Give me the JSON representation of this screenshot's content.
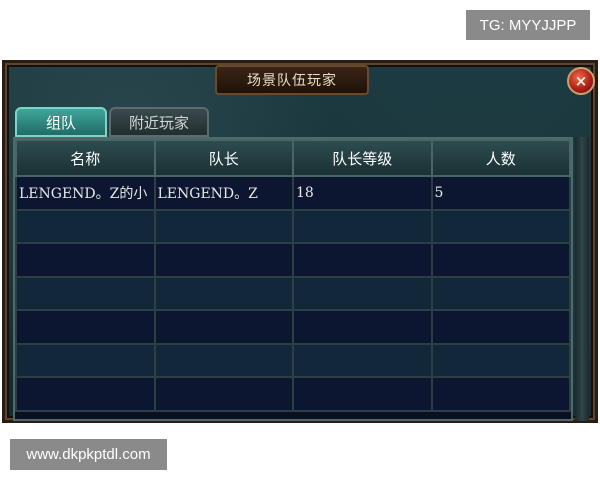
{
  "watermarks": {
    "top": "TG: MYYJJPP",
    "bottom": "www.dkpkptdl.com"
  },
  "window": {
    "title": "场景队伍玩家",
    "close_label": "×"
  },
  "tabs": [
    {
      "label": "组队",
      "active": true
    },
    {
      "label": "附近玩家",
      "active": false
    }
  ],
  "table": {
    "headers": [
      "名称",
      "队长",
      "队长等级",
      "人数"
    ],
    "rows": [
      [
        "LENGEND。Z的小",
        "LENGEND。Z",
        "18",
        "5"
      ],
      [
        "",
        "",
        "",
        ""
      ],
      [
        "",
        "",
        "",
        ""
      ],
      [
        "",
        "",
        "",
        ""
      ],
      [
        "",
        "",
        "",
        ""
      ],
      [
        "",
        "",
        "",
        ""
      ],
      [
        "",
        "",
        "",
        ""
      ]
    ]
  },
  "colors": {
    "tab_active": "#2f8c84",
    "row_bg": "#0d1630",
    "close_button": "#c0281e"
  }
}
